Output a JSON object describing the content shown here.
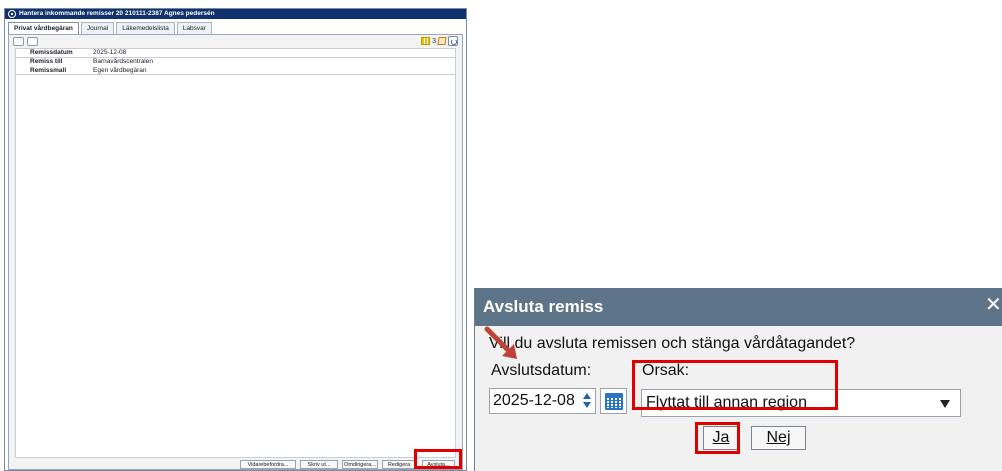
{
  "window": {
    "title": "Hantera inkommande remisser 20 210111-2387 Agnes pedersén"
  },
  "tabs": [
    {
      "label": "Privat vårdbegäran",
      "active": true
    },
    {
      "label": "Journal",
      "active": false
    },
    {
      "label": "Läkemedelslista",
      "active": false
    },
    {
      "label": "Labsvar",
      "active": false
    }
  ],
  "toolbar": {
    "count": "3",
    "icons": [
      "document-icon",
      "notes-icon",
      "grid-icon",
      "note-icon",
      "refresh-icon"
    ]
  },
  "referral": {
    "rows": [
      {
        "label": "Remissdatum",
        "value": "2025-12-08"
      },
      {
        "label": "Remiss till",
        "value": "Barnavårdscentralen"
      },
      {
        "label": "Remissmall",
        "value": "Egen vårdbegäran"
      }
    ]
  },
  "bottom_buttons": {
    "forward": "Vidarebefordra...",
    "print": "Skriv ut...",
    "reroute": "Omdirigera...",
    "edit": "Redigera",
    "close": "Avsluta..."
  },
  "dialog": {
    "title": "Avsluta remiss",
    "question": "Vill du avsluta remissen och stänga vårdåtagandet?",
    "date_label": "Avslutsdatum:",
    "date_value": "2025-12-08",
    "reason_label": "Orsak:",
    "reason_value": "Flyttat till annan region",
    "yes_label": "Ja",
    "no_label": "Nej",
    "close_symbol": "✕"
  },
  "colors": {
    "title_bar": "#10306e",
    "dialog_header": "#5e7489",
    "highlight": "#e00000",
    "arrow": "#c0433a"
  }
}
